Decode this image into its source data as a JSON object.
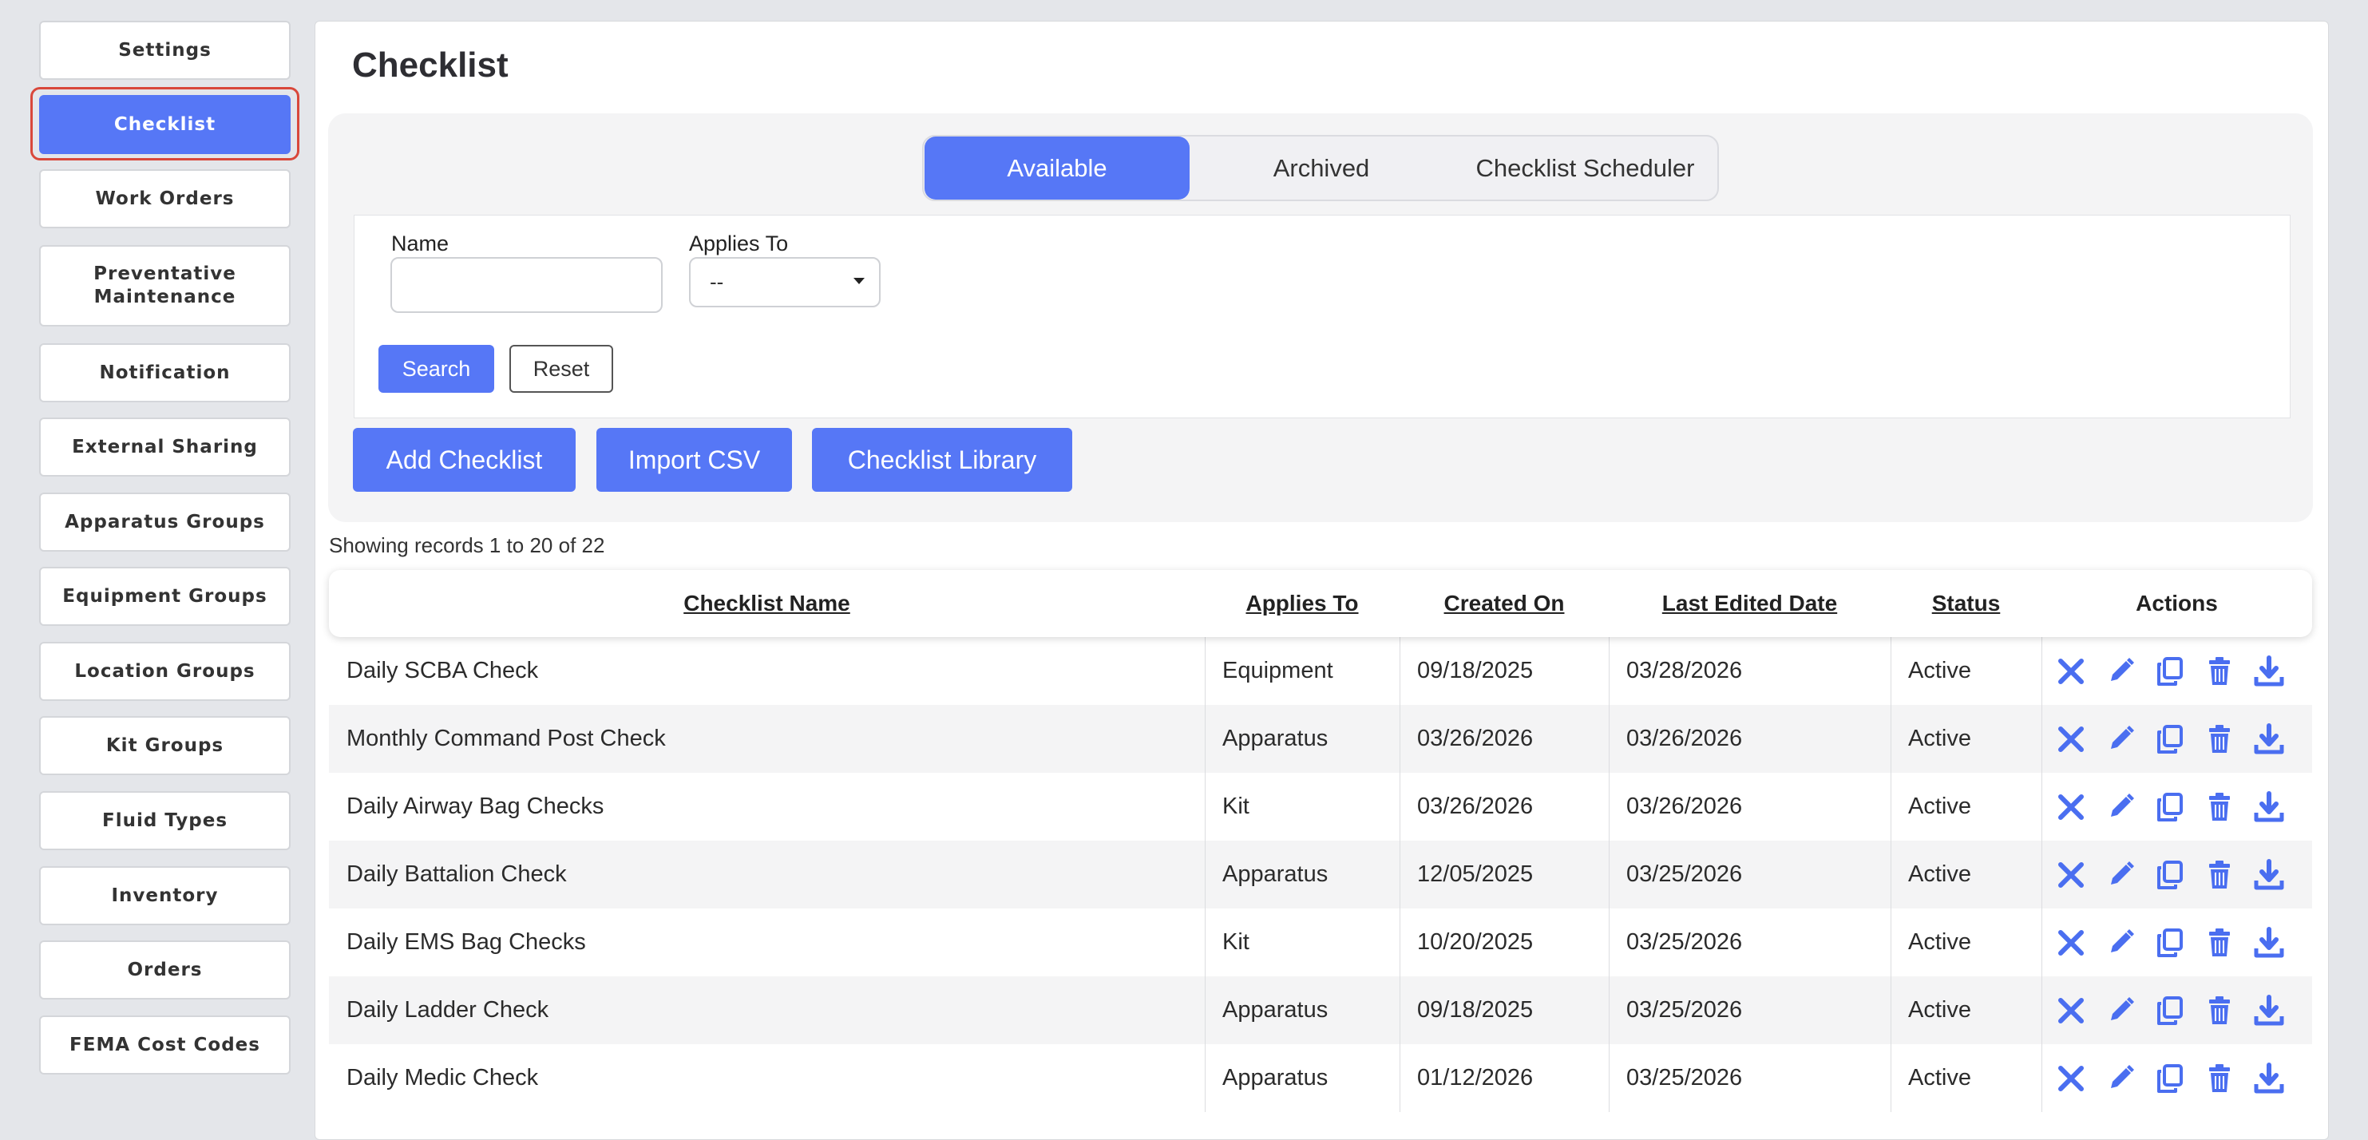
{
  "sidebar": {
    "items": [
      {
        "label": "Settings"
      },
      {
        "label": "Checklist",
        "active": true
      },
      {
        "label": "Work Orders"
      },
      {
        "label": "Preventative Maintenance"
      },
      {
        "label": "Notification"
      },
      {
        "label": "External Sharing"
      },
      {
        "label": "Apparatus Groups"
      },
      {
        "label": "Equipment Groups"
      },
      {
        "label": "Location Groups"
      },
      {
        "label": "Kit Groups"
      },
      {
        "label": "Fluid Types"
      },
      {
        "label": "Inventory"
      },
      {
        "label": "Orders"
      },
      {
        "label": "FEMA Cost Codes"
      }
    ]
  },
  "page": {
    "title": "Checklist"
  },
  "tabs": [
    {
      "label": "Available",
      "active": true
    },
    {
      "label": "Archived"
    },
    {
      "label": "Checklist Scheduler"
    }
  ],
  "filters": {
    "name_label": "Name",
    "name_value": "",
    "applies_label": "Applies To",
    "applies_value": "--",
    "search_label": "Search",
    "reset_label": "Reset"
  },
  "toolbar": {
    "add_label": "Add Checklist",
    "import_label": "Import CSV",
    "library_label": "Checklist Library"
  },
  "records_text": "Showing records 1 to 20 of 22",
  "table": {
    "headers": [
      "Checklist Name",
      "Applies To",
      "Created On",
      "Last Edited Date",
      "Status",
      "Actions"
    ],
    "rows": [
      [
        "Daily SCBA Check",
        "Equipment",
        "09/18/2025",
        "03/28/2026",
        "Active"
      ],
      [
        "Monthly Command Post Check",
        "Apparatus",
        "03/26/2026",
        "03/26/2026",
        "Active"
      ],
      [
        "Daily Airway Bag Checks",
        "Kit",
        "03/26/2026",
        "03/26/2026",
        "Active"
      ],
      [
        "Daily Battalion Check",
        "Apparatus",
        "12/05/2025",
        "03/25/2026",
        "Active"
      ],
      [
        "Daily EMS Bag Checks",
        "Kit",
        "10/20/2025",
        "03/25/2026",
        "Active"
      ],
      [
        "Daily Ladder Check",
        "Apparatus",
        "09/18/2025",
        "03/25/2026",
        "Active"
      ],
      [
        "Daily Medic Check",
        "Apparatus",
        "01/12/2026",
        "03/25/2026",
        "Active"
      ]
    ],
    "row_actions": [
      "archive-icon",
      "edit-icon",
      "copy-icon",
      "delete-icon",
      "download-icon"
    ]
  },
  "colors": {
    "accent": "#5677f6",
    "focus_ring": "#d9483b",
    "icon": "#4a6ef0"
  }
}
